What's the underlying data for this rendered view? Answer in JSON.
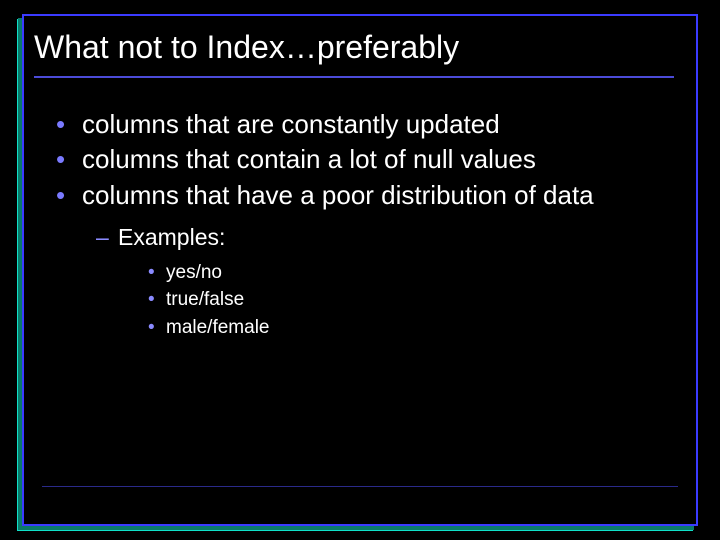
{
  "title": "What not to Index…preferably",
  "bullets": {
    "b1": "columns that are constantly updated",
    "b2": "columns that contain a lot of null values",
    "b3": "columns that have a poor distribution of data"
  },
  "sub": {
    "examples_label": "Examples:",
    "e1": "yes/no",
    "e2": "true/false",
    "e3": "male/female"
  }
}
